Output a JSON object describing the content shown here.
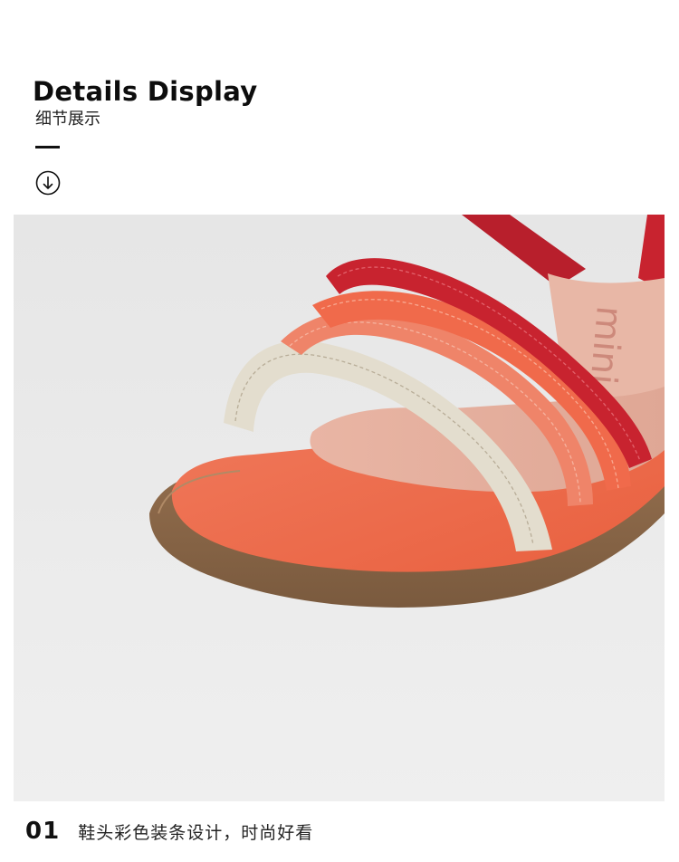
{
  "header": {
    "title": "Details Display",
    "subtitle": "细节展示"
  },
  "icons": {
    "scroll_down": "arrow-down-circle-icon"
  },
  "product_image": {
    "sole_print": "mini"
  },
  "caption": {
    "number": "01",
    "text": "鞋头彩色装条设计，时尚好看"
  },
  "colors": {
    "strap_red": "#c8232f",
    "strap_salmon": "#ee7c63",
    "strap_coral": "#f0603f",
    "strap_cream": "#e2dccd",
    "insole_coral": "#ee6f50",
    "outsole_brown": "#8a6647",
    "background_gray": "#ebebeb"
  }
}
